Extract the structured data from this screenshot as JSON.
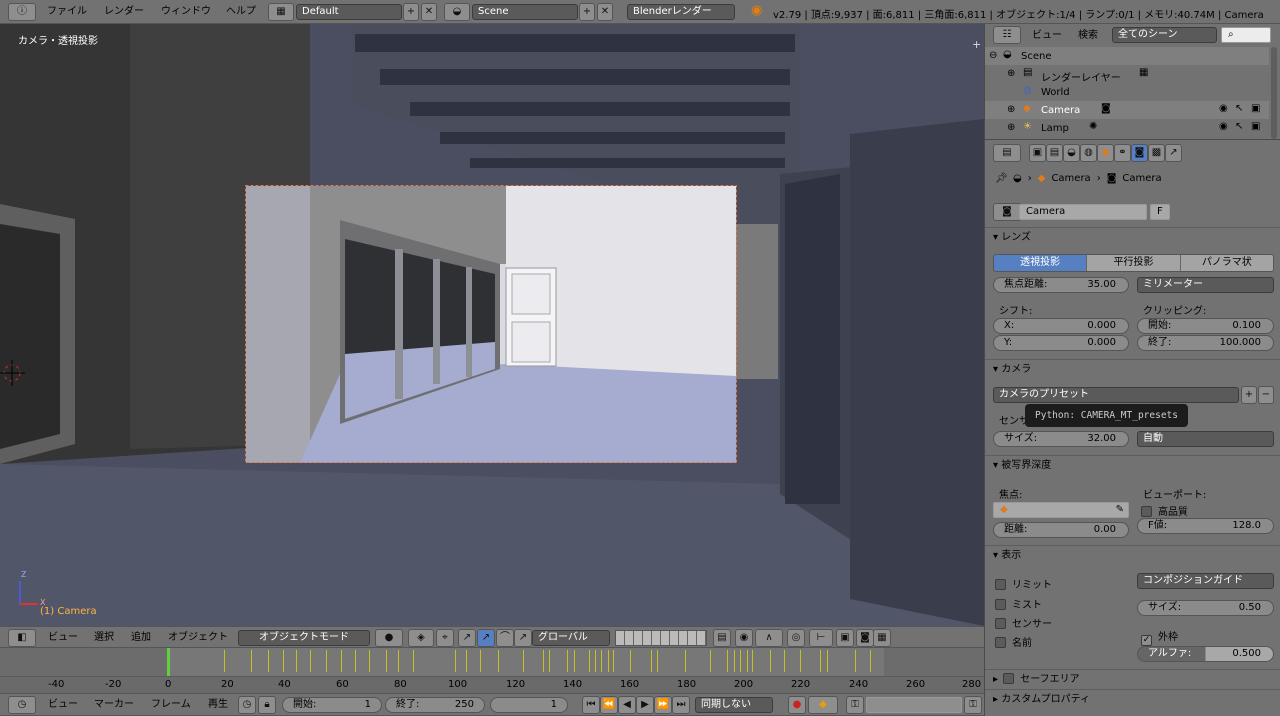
{
  "topbar": {
    "menus": [
      "ファイル",
      "レンダー",
      "ウィンドウ",
      "ヘルプ"
    ],
    "layout": "Default",
    "scene": "Scene",
    "engine": "Blenderレンダー",
    "stats": "v2.79 | 頂点:9,937 | 面:6,811 | 三角面:6,811 | オブジェクト:1/4 | ランプ:0/1 | メモリ:40.74M | Camera"
  },
  "viewport": {
    "title": "カメラ・透視投影",
    "object_label": "(1) Camera",
    "axis_x": "X",
    "axis_z": "Z"
  },
  "viewport_header": {
    "menus": [
      "ビュー",
      "選択",
      "追加",
      "オブジェクト"
    ],
    "mode": "オブジェクトモード",
    "orientation": "グローバル"
  },
  "outliner": {
    "menus": [
      "ビュー",
      "検索"
    ],
    "filter": "全てのシーン",
    "items": [
      {
        "label": "Scene"
      },
      {
        "label": "レンダーレイヤー"
      },
      {
        "label": "World"
      },
      {
        "label": "Camera"
      },
      {
        "label": "Lamp"
      }
    ]
  },
  "properties": {
    "breadcrumb": [
      "Camera",
      "Camera"
    ],
    "datablock": "Camera",
    "fake_user": "F",
    "lens": {
      "title": "レンズ",
      "types": [
        "透視投影",
        "平行投影",
        "パノラマ状"
      ],
      "focal_label": "焦点距離:",
      "focal_value": "35.00",
      "unit": "ミリメーター",
      "shift_label": "シフト:",
      "clip_label": "クリッピング:",
      "shift_x_label": "X:",
      "shift_x": "0.000",
      "shift_y_label": "Y:",
      "shift_y": "0.000",
      "clip_start_label": "開始:",
      "clip_start": "0.100",
      "clip_end_label": "終了:",
      "clip_end": "100.000"
    },
    "camera": {
      "title": "カメラ",
      "presets": "カメラのプリセット",
      "sensor_label": "センサー",
      "size_label": "サイズ:",
      "size_value": "32.00",
      "fit": "自動",
      "tooltip": "Python: CAMERA_MT_presets"
    },
    "dof": {
      "title": "被写界深度",
      "focus_label": "焦点:",
      "viewport_label": "ビューポート:",
      "hq_label": "高品質",
      "dist_label": "距離:",
      "dist_value": "0.00",
      "fstop_label": "F値:",
      "fstop_value": "128.0"
    },
    "display": {
      "title": "表示",
      "checks": [
        "リミット",
        "ミスト",
        "センサー",
        "名前"
      ],
      "guide": "コンポジションガイド",
      "size_label": "サイズ:",
      "size_value": "0.50",
      "passepartout": "外枠",
      "alpha_label": "アルファ:",
      "alpha_value": "0.500"
    },
    "safe_area": "セーフエリア",
    "custom_props": "カスタムプロパティ"
  },
  "timeline": {
    "ruler": [
      "-40",
      "-20",
      "0",
      "20",
      "40",
      "60",
      "80",
      "100",
      "120",
      "140",
      "160",
      "180",
      "200",
      "220",
      "240",
      "260",
      "280"
    ],
    "menus": [
      "ビュー",
      "マーカー",
      "フレーム",
      "再生"
    ],
    "start_label": "開始:",
    "start": "1",
    "end_label": "終了:",
    "end": "250",
    "current": "1",
    "sync": "同期しない"
  }
}
